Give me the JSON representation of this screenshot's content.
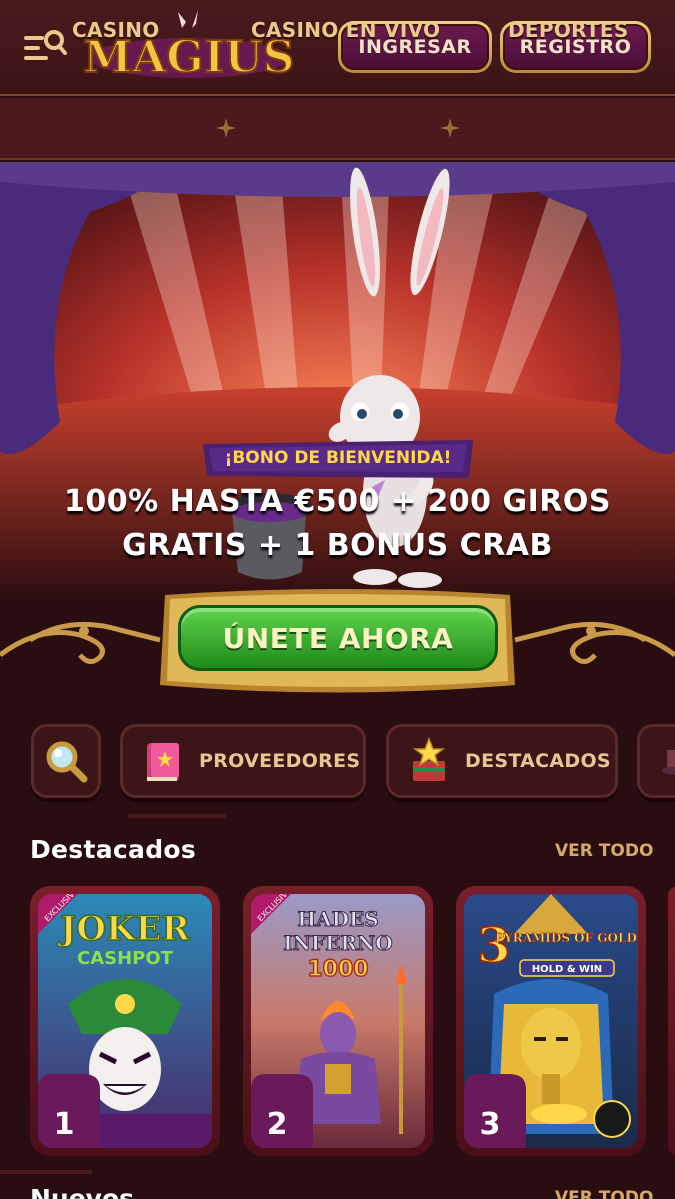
{
  "header": {
    "logo_text": "MAGIUS",
    "login_label": "INGRESAR",
    "register_label": "REGISTRO"
  },
  "nav": {
    "items": [
      "CASINO",
      "CASINO EN VIVO",
      "DEPORTES"
    ]
  },
  "hero": {
    "badge": "¡BONO DE BIENVENIDA!",
    "line1": "100% HASTA €500 + 200 GIROS",
    "line2": "GRATIS + 1 BONUS CRAB",
    "cta_label": "ÚNETE AHORA"
  },
  "categories": {
    "search_icon": "magnifier-icon",
    "providers_label": "PROVEEDORES",
    "featured_label": "DESTACADOS"
  },
  "featured": {
    "title": "Destacados",
    "see_all": "VER TODO",
    "games": [
      {
        "rank": "1",
        "name_line1": "JOKER",
        "name_line2": "CASHPOT",
        "tag": "EXCLUSIVE"
      },
      {
        "rank": "2",
        "name_line1": "HADES",
        "name_line2": "INFERNO",
        "name_line3": "1000",
        "tag": "EXCLUSIVE"
      },
      {
        "rank": "3",
        "name_line1": "3",
        "name_line2": "PYRAMIDS OF GOLD",
        "name_line3": "HOLD & WIN"
      }
    ]
  },
  "new_section": {
    "title": "Nuevos",
    "see_all": "VER TODO"
  },
  "colors": {
    "background": "#2a0d10",
    "gold": "#e9c98c",
    "cta_green": "#3cb534",
    "button_purple": "#5a1442"
  }
}
